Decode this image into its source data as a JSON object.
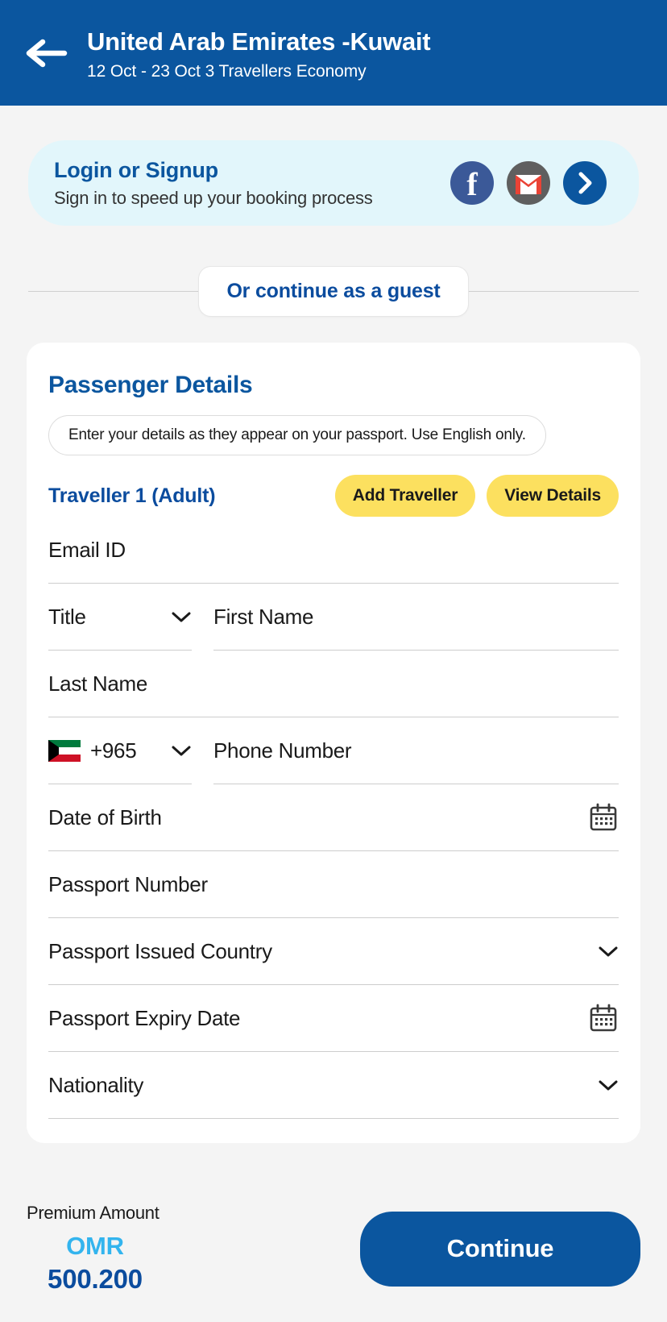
{
  "header": {
    "back_icon": "back-arrow-icon",
    "title": "United Arab Emirates -Kuwait",
    "subtitle": "12 Oct - 23 Oct 3 Travellers Economy",
    "bg_color": "#0B569F"
  },
  "login_banner": {
    "title": "Login or Signup",
    "subtitle": "Sign in to speed up your booking process",
    "bg_color": "#E2F6FB",
    "icons": [
      {
        "name": "facebook-icon",
        "glyph": "f",
        "color": "#3B5998"
      },
      {
        "name": "gmail-icon",
        "glyph": "M",
        "color": "#EA4335"
      },
      {
        "name": "arrow-right-icon",
        "glyph": "›",
        "color": "#0B569F"
      }
    ]
  },
  "guest": {
    "label": "Or continue as a guest"
  },
  "passenger": {
    "title": "Passenger Details",
    "hint": "Enter your details as they appear on your passport. Use English only.",
    "traveller_label": "Traveller 1 (Adult)",
    "add_traveller_label": "Add Traveller",
    "view_details_label": "View Details",
    "button_color": "#FCE05F",
    "fields": {
      "email": {
        "label": "Email ID",
        "value": ""
      },
      "title": {
        "label": "Title",
        "value": ""
      },
      "first_name": {
        "label": "First Name",
        "value": ""
      },
      "last_name": {
        "label": "Last Name",
        "value": ""
      },
      "country_code": {
        "label": "+965",
        "flag": "kuwait-flag-icon"
      },
      "phone": {
        "label": "Phone Number",
        "value": ""
      },
      "dob": {
        "label": "Date of Birth",
        "value": ""
      },
      "passport_number": {
        "label": "Passport Number",
        "value": ""
      },
      "passport_country": {
        "label": "Passport Issued Country",
        "value": ""
      },
      "passport_expiry": {
        "label": "Passport Expiry Date",
        "value": ""
      },
      "nationality": {
        "label": "Nationality",
        "value": ""
      }
    }
  },
  "footer": {
    "price_caption": "Premium Amount",
    "currency": "OMR",
    "amount": "500.200",
    "currency_color": "#33B4EE",
    "amount_color": "#0B4C9E",
    "continue_label": "Continue",
    "continue_color": "#0B569F"
  }
}
